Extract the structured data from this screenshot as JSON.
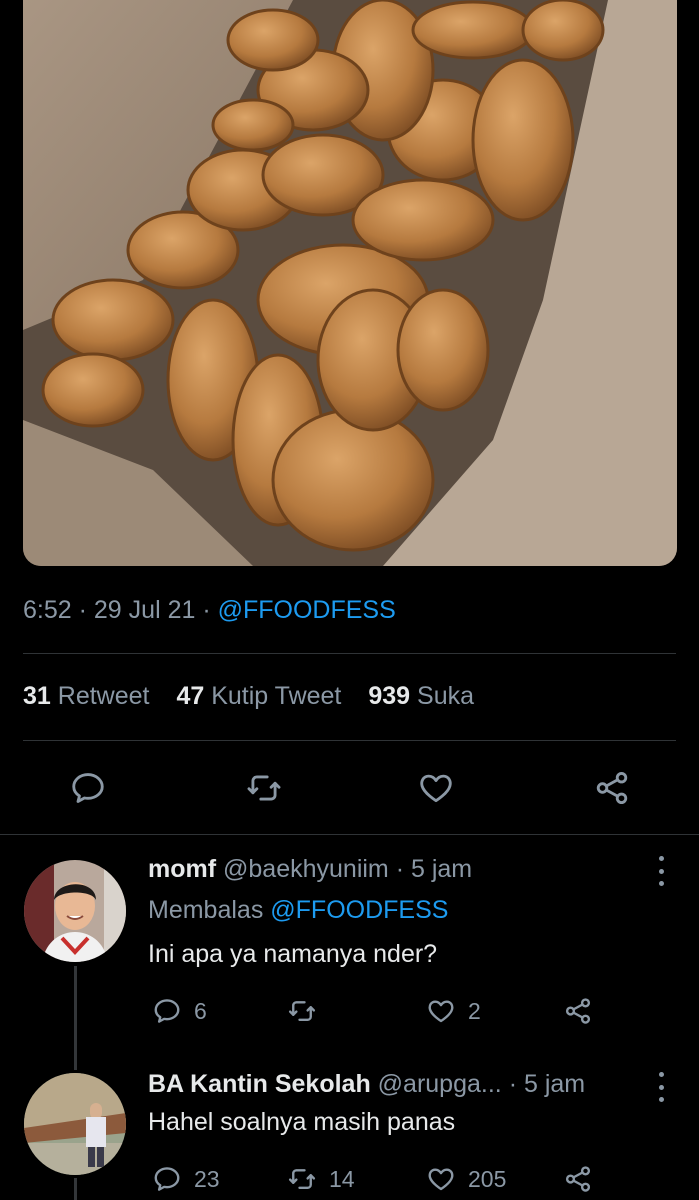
{
  "tweet": {
    "time": "6:52",
    "date": "29 Jul 21",
    "source_handle": "@FFOODFESS",
    "stats": [
      {
        "count": "31",
        "label": "Retweet"
      },
      {
        "count": "47",
        "label": "Kutip Tweet"
      },
      {
        "count": "939",
        "label": "Suka"
      }
    ]
  },
  "replies": [
    {
      "name": "momf",
      "handle": "@baekhyuniim",
      "time": "5 jam",
      "replying_prefix": "Membalas",
      "replying_to": "@FFOODFESS",
      "text": "Ini apa ya namanya nder?",
      "reply_count": "6",
      "retweet_count": "",
      "like_count": "2"
    },
    {
      "name": "BA Kantin Sekolah",
      "handle": "@arupga...",
      "time": "5 jam",
      "text": "Hahel soalnya masih panas",
      "reply_count": "23",
      "retweet_count": "14",
      "like_count": "205"
    }
  ],
  "colors": {
    "background": "#000000",
    "text": "#e7e9ea",
    "muted": "#8b98a5",
    "link": "#1d9bf0",
    "divider": "#2f3336"
  }
}
